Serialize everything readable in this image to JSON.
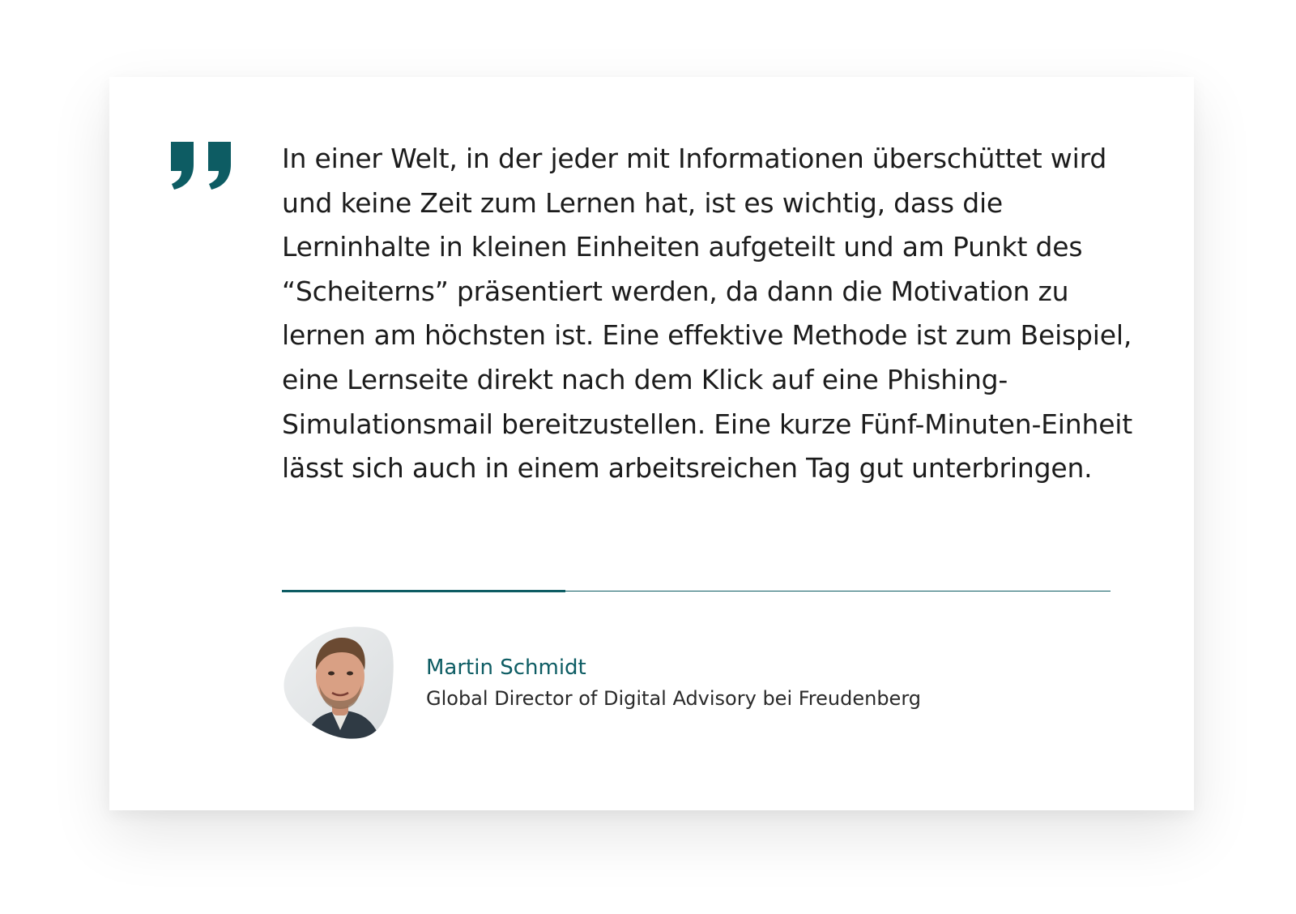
{
  "quote": {
    "text": "In einer Welt, in der jeder mit Informationen überschüttet wird und keine Zeit zum Lernen hat, ist es wichtig, dass die Lerninhalte in kleinen Einheiten aufgeteilt und am Punkt des “Scheiterns” präsentiert werden, da dann die Motivation zu lernen am höchsten ist. Eine effektive Methode ist zum Beispiel, eine Lernseite direkt nach dem Klick auf eine Phishing-Simulationsmail bereitzustellen. Eine kurze Fünf-Minuten-Einheit lässt sich auch in einem arbeitsreichen Tag gut unterbringen.",
    "icon": "quote-mark-icon"
  },
  "author": {
    "name": "Martin Schmidt",
    "title": "Global Director of Digital Advisory bei Freudenberg",
    "avatar_icon": "person-photo"
  },
  "colors": {
    "accent": "#0d5c63",
    "text": "#1c1c1c",
    "background": "#ffffff"
  }
}
